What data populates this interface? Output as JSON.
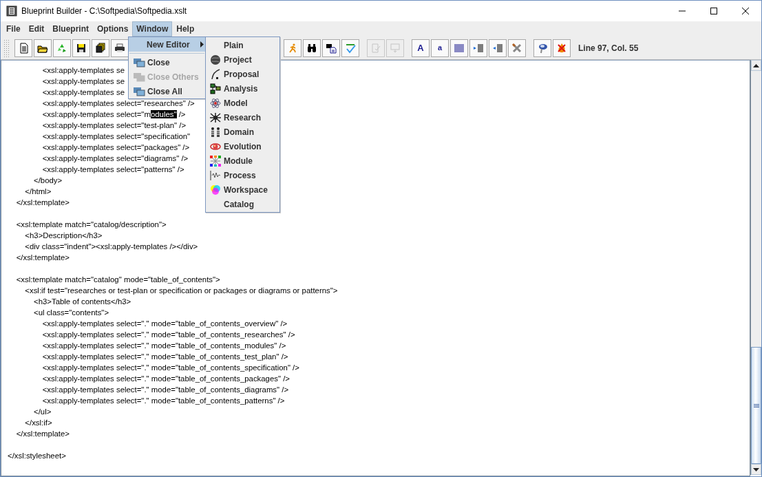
{
  "window": {
    "title": "Blueprint Builder - C:\\Softpedia\\Softpedia.xslt"
  },
  "menubar": [
    {
      "label": "File",
      "selected": false
    },
    {
      "label": "Edit",
      "selected": false
    },
    {
      "label": "Blueprint",
      "selected": false
    },
    {
      "label": "Options",
      "selected": false
    },
    {
      "label": "Window",
      "selected": true
    },
    {
      "label": "Help",
      "selected": false
    }
  ],
  "toolbar": {
    "groups": [
      [
        {
          "disabled": false
        },
        {
          "disabled": false
        },
        {
          "disabled": false
        },
        {
          "disabled": false
        },
        {
          "disabled": false
        },
        {
          "disabled": false
        }
      ],
      [
        {
          "disabled": false
        },
        {
          "disabled": false
        },
        {
          "disabled": false
        },
        {
          "disabled": false
        }
      ],
      [
        {
          "disabled": true
        },
        {
          "disabled": true
        }
      ],
      [
        {
          "disabled": false,
          "label": "A"
        },
        {
          "disabled": false,
          "label": "a"
        },
        {
          "disabled": false
        },
        {
          "disabled": false
        },
        {
          "disabled": false
        },
        {
          "disabled": false
        }
      ],
      [
        {
          "disabled": false
        },
        {
          "disabled": false
        }
      ]
    ],
    "status": "Line 97, Col. 55"
  },
  "window_menu": [
    {
      "kind": "submenu",
      "label": "New Editor",
      "selected": true,
      "disabled": false
    },
    {
      "kind": "separator"
    },
    {
      "kind": "item",
      "label": "Close",
      "selected": false,
      "disabled": false
    },
    {
      "kind": "item",
      "label": "Close Others",
      "selected": false,
      "disabled": true
    },
    {
      "kind": "item",
      "label": "Close All",
      "selected": false,
      "disabled": false
    }
  ],
  "new_editor_menu": [
    {
      "label": "Plain"
    },
    {
      "label": "Project"
    },
    {
      "label": "Proposal"
    },
    {
      "label": "Analysis"
    },
    {
      "label": "Model"
    },
    {
      "label": "Research"
    },
    {
      "label": "Domain"
    },
    {
      "label": "Evolution"
    },
    {
      "label": "Module"
    },
    {
      "label": "Process"
    },
    {
      "label": "Workspace"
    },
    {
      "label": "Catalog"
    }
  ],
  "editor": {
    "lines": [
      {
        "kind": "code",
        "text": "                <xsl:apply-templates se"
      },
      {
        "kind": "code",
        "text": "                <xsl:apply-templates se"
      },
      {
        "kind": "code",
        "text": "                <xsl:apply-templates se"
      },
      {
        "kind": "code",
        "text": "                <xsl:apply-templates select=\"researches\" />"
      },
      {
        "kind": "segments",
        "segments": [
          {
            "text": "                <xsl:apply-templates select=\"m",
            "selected": false
          },
          {
            "text": "odules\"",
            "selected": true
          },
          {
            "text": " />",
            "selected": false
          }
        ]
      },
      {
        "kind": "code",
        "text": "                <xsl:apply-templates select=\"test-plan\" />"
      },
      {
        "kind": "code",
        "text": "                <xsl:apply-templates select=\"specification\""
      },
      {
        "kind": "code",
        "text": "                <xsl:apply-templates select=\"packages\" />"
      },
      {
        "kind": "code",
        "text": "                <xsl:apply-templates select=\"diagrams\" />"
      },
      {
        "kind": "code",
        "text": "                <xsl:apply-templates select=\"patterns\" />"
      },
      {
        "kind": "code",
        "text": "            </body>"
      },
      {
        "kind": "code",
        "text": "        </html>"
      },
      {
        "kind": "code",
        "text": "    </xsl:template>"
      },
      {
        "kind": "blank"
      },
      {
        "kind": "code",
        "text": "    <xsl:template match=\"catalog/description\">"
      },
      {
        "kind": "code",
        "text": "        <h3>Description</h3>"
      },
      {
        "kind": "code",
        "text": "        <div class=\"indent\"><xsl:apply-templates /></div>"
      },
      {
        "kind": "code",
        "text": "    </xsl:template>"
      },
      {
        "kind": "blank"
      },
      {
        "kind": "code",
        "text": "    <xsl:template match=\"catalog\" mode=\"table_of_contents\">"
      },
      {
        "kind": "code",
        "text": "        <xsl:if test=\"researches or test-plan or specification or packages or diagrams or patterns\">"
      },
      {
        "kind": "code",
        "text": "            <h3>Table of contents</h3>"
      },
      {
        "kind": "code",
        "text": "            <ul class=\"contents\">"
      },
      {
        "kind": "code",
        "text": "                <xsl:apply-templates select=\".\" mode=\"table_of_contents_overview\" />"
      },
      {
        "kind": "code",
        "text": "                <xsl:apply-templates select=\".\" mode=\"table_of_contents_researches\" />"
      },
      {
        "kind": "code",
        "text": "                <xsl:apply-templates select=\".\" mode=\"table_of_contents_modules\" />"
      },
      {
        "kind": "code",
        "text": "                <xsl:apply-templates select=\".\" mode=\"table_of_contents_test_plan\" />"
      },
      {
        "kind": "code",
        "text": "                <xsl:apply-templates select=\".\" mode=\"table_of_contents_specification\" />"
      },
      {
        "kind": "code",
        "text": "                <xsl:apply-templates select=\".\" mode=\"table_of_contents_packages\" />"
      },
      {
        "kind": "code",
        "text": "                <xsl:apply-templates select=\".\" mode=\"table_of_contents_diagrams\" />"
      },
      {
        "kind": "code",
        "text": "                <xsl:apply-templates select=\".\" mode=\"table_of_contents_patterns\" />"
      },
      {
        "kind": "code",
        "text": "            </ul>"
      },
      {
        "kind": "code",
        "text": "        </xsl:if>"
      },
      {
        "kind": "code",
        "text": "    </xsl:template>"
      },
      {
        "kind": "blank"
      },
      {
        "kind": "code",
        "text": "</xsl:stylesheet>"
      }
    ]
  }
}
